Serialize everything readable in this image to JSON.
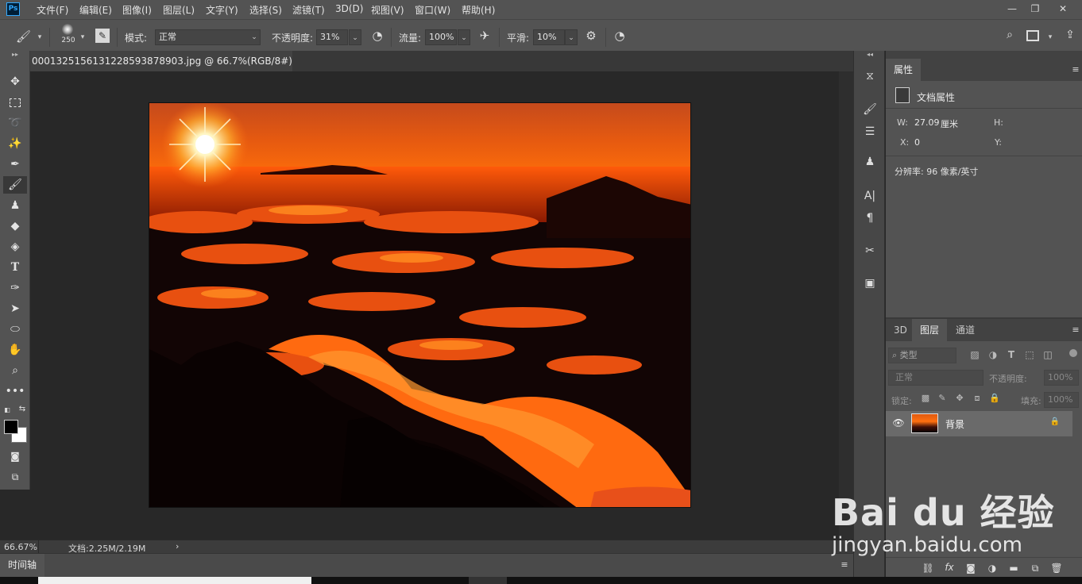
{
  "app": {
    "logo": "Ps"
  },
  "menu": [
    "文件(F)",
    "编辑(E)",
    "图像(I)",
    "图层(L)",
    "文字(Y)",
    "选择(S)",
    "滤镜(T)",
    "3D(D)",
    "视图(V)",
    "窗口(W)",
    "帮助(H)"
  ],
  "options": {
    "brush_size": "250",
    "mode_label": "模式:",
    "mode_value": "正常",
    "opacity_label": "不透明度:",
    "opacity_value": "31%",
    "flow_label": "流量:",
    "flow_value": "100%",
    "smooth_label": "平滑:",
    "smooth_value": "10%"
  },
  "document": {
    "tab_title": "0001325156131228593878903.jpg @ 66.7%(RGB/8#) *",
    "close_glyph": "×"
  },
  "status": {
    "zoom": "66.67%",
    "doc_info": "文档:2.25M/2.19M",
    "arrow": "›"
  },
  "timeline": {
    "label": "时间轴"
  },
  "properties": {
    "tab": "属性",
    "section": "文档属性",
    "w_label": "W:",
    "w_value": "27.09",
    "w_unit": "厘米",
    "h_label": "H:",
    "x_label": "X:",
    "x_value": "0",
    "y_label": "Y:",
    "resolution": "分辨率: 96 像素/英寸"
  },
  "layers": {
    "tabs": [
      "3D",
      "图层",
      "通道"
    ],
    "filter_label": "类型",
    "blend_mode": "正常",
    "opacity_label": "不透明度:",
    "opacity_value": "100%",
    "lock_label": "锁定:",
    "fill_label": "填充:",
    "fill_value": "100%",
    "layer_name": "背景"
  },
  "watermark": {
    "brand": "Bai du 经验",
    "url": "jingyan.baidu.com"
  },
  "colors": {
    "accent": "#31a8ff",
    "panel": "#535353",
    "canvas": "#282828"
  }
}
